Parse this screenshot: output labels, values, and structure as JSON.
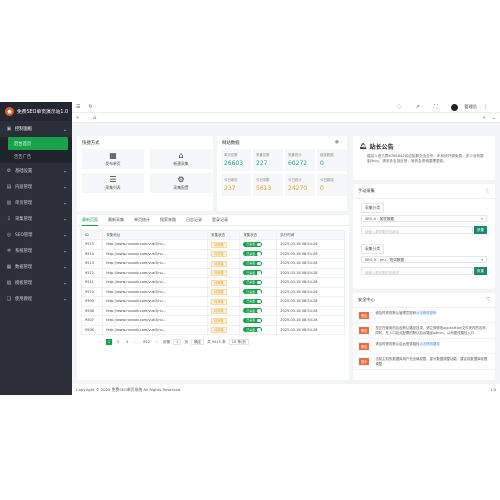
{
  "brand": {
    "title": "免费SEO单页演示站1.0"
  },
  "sidebar": {
    "items": [
      {
        "label": "控制面板",
        "icon": "monitor-icon",
        "glyph": "▣",
        "open": true,
        "sub": [
          {
            "label": "后台首页",
            "active": true
          },
          {
            "label": "告告广告",
            "active": false
          }
        ]
      },
      {
        "label": "基础设置",
        "icon": "gear-icon",
        "glyph": "⚙"
      },
      {
        "label": "内容管理",
        "icon": "document-icon",
        "glyph": "▤"
      },
      {
        "label": "单页管理",
        "icon": "page-icon",
        "glyph": "▥"
      },
      {
        "label": "采集管理",
        "icon": "download-icon",
        "glyph": "⇩"
      },
      {
        "label": "SEO管理",
        "icon": "seo-icon",
        "glyph": "◎"
      },
      {
        "label": "系统管理",
        "icon": "settings-icon",
        "glyph": "✲"
      },
      {
        "label": "数据管理",
        "icon": "database-icon",
        "glyph": "▦"
      },
      {
        "label": "模板管理",
        "icon": "template-icon",
        "glyph": "▧"
      },
      {
        "label": "使用教程",
        "icon": "book-icon",
        "glyph": "❑"
      }
    ]
  },
  "topbar": {
    "username": "管理员"
  },
  "quick": {
    "title": "快捷方式",
    "items": [
      {
        "label": "发布单页",
        "icon": "grid-add-icon",
        "glyph": "▦"
      },
      {
        "label": "新建采集",
        "icon": "sofa-icon",
        "glyph": "⌂"
      },
      {
        "label": "采集列表",
        "icon": "list-icon",
        "glyph": "☰"
      },
      {
        "label": "采集配置",
        "icon": "gear-icon",
        "glyph": "⚙"
      }
    ]
  },
  "stats": {
    "title": "网站数据",
    "items": [
      {
        "label": "单页总数",
        "value": "26603",
        "color": "green"
      },
      {
        "label": "采集总数",
        "value": "227",
        "color": "green"
      },
      {
        "label": "采集统计",
        "value": "60272",
        "color": "green"
      },
      {
        "label": "链接数据",
        "value": "0",
        "color": "green"
      },
      {
        "label": "今日单页",
        "value": "237",
        "color": "orange"
      },
      {
        "label": "今日采集",
        "value": "5613",
        "color": "orange"
      },
      {
        "label": "今日统计",
        "value": "24270",
        "color": "orange"
      },
      {
        "label": "今日链接",
        "value": "0",
        "color": "orange"
      }
    ]
  },
  "notice": {
    "title": "站长公告",
    "text": "建站人官方群6784842欢迎加群交流合作，本系统开源免费，多少没有限制/bug，请多多支持反馈，我的会采纳整理更新。"
  },
  "manual": {
    "title": "手动采集",
    "group1": {
      "label": "采集分类",
      "select": "SEO-5 - 某些数据",
      "placeholder": "请输入要采集的关键词",
      "button": "采集"
    },
    "group2": {
      "label": "采集分类",
      "select": "SEO-5 - (m) - 短词数据",
      "placeholder": "请输入要采集的关键词",
      "button": "采集"
    }
  },
  "security": {
    "title": "安全中心",
    "items": [
      {
        "badge": "警告",
        "text": "请及时修改默认管理员密码",
        "link": "点击修改密码"
      },
      {
        "badge": "警告",
        "text": "您正在使用的后台默认路径目录，请立即修改application文件夹内的名称，同时，在入口站点配置的默认后台路径admin，从而更改路径入口",
        "link": ""
      },
      {
        "badge": "警告",
        "text": "请及时修改默认后台登录路径",
        "link": "点击修改路径"
      },
      {
        "badge": "提示",
        "text": "当前主机的数据库用户无全局权限，部分数据调整功能，建议将数据库权限调整",
        "link": ""
      }
    ]
  },
  "table": {
    "tabs": [
      "最新页面",
      "最新采集",
      "单页统计",
      "搜索来路",
      "日志记录",
      "登录记录"
    ],
    "columns": [
      "ID",
      "采集地址",
      "采集状态",
      "采集状态",
      "执行时间"
    ],
    "rows": [
      {
        "id": "9515",
        "url": "http://www.runoob.com/vue3/nu...",
        "status": "待采集",
        "switch": "已采集",
        "time": "2025-03-18 08:54:28"
      },
      {
        "id": "9514",
        "url": "http://www.runoob.com/vue3/nu...",
        "status": "待采集",
        "switch": "已采集",
        "time": "2025-03-18 08:54:28"
      },
      {
        "id": "9513",
        "url": "http://www.runoob.com/vue3/nu...",
        "status": "待采集",
        "switch": "已采集",
        "time": "2025-03-18 08:54:28"
      },
      {
        "id": "9512",
        "url": "http://www.runoob.com/vue3/nu...",
        "status": "待采集",
        "switch": "已采集",
        "time": "2025-03-18 08:54:28"
      },
      {
        "id": "9511",
        "url": "http://www.runoob.com/vue3/nu...",
        "status": "待采集",
        "switch": "已采集",
        "time": "2025-03-18 08:54:28"
      },
      {
        "id": "9510",
        "url": "http://www.runoob.com/vue3/nu...",
        "status": "待采集",
        "switch": "已采集",
        "time": "2025-03-18 08:54:28"
      },
      {
        "id": "9509",
        "url": "http://www.runoob.com/vue3/nu...",
        "status": "待采集",
        "switch": "已采集",
        "time": "2025-03-18 08:54:28"
      },
      {
        "id": "9508",
        "url": "http://www.runoob.com/vue3/nu...",
        "status": "待采集",
        "switch": "已采集",
        "time": "2025-03-18 08:54:28"
      },
      {
        "id": "9507",
        "url": "http://www.runoob.com/vue3/nu...",
        "status": "待采集",
        "switch": "已采集",
        "time": "2025-03-18 08:54:28"
      },
      {
        "id": "9506",
        "url": "http://www.runoob.com/vue3/nu...",
        "status": "待采集",
        "switch": "已采集",
        "time": "2025-03-18 08:54:28"
      }
    ],
    "pager": {
      "pages": [
        "1",
        "2",
        "3",
        "...",
        "952"
      ],
      "goto_label": "到第",
      "goto_value": "1",
      "page_unit": "页",
      "confirm": "确定",
      "total": "共 9515 条",
      "page_size": "10 条/页"
    }
  },
  "footer": {
    "copyright": "Copyright © 2025 免费SEO单页系统 All Rights Reserved",
    "version": "1.0"
  },
  "colors": {
    "sidebar": "#2b2f3a",
    "accent": "#16a34a",
    "stat_green": "#20a789",
    "stat_orange": "#f0a020",
    "warning": "#f06a3c"
  }
}
